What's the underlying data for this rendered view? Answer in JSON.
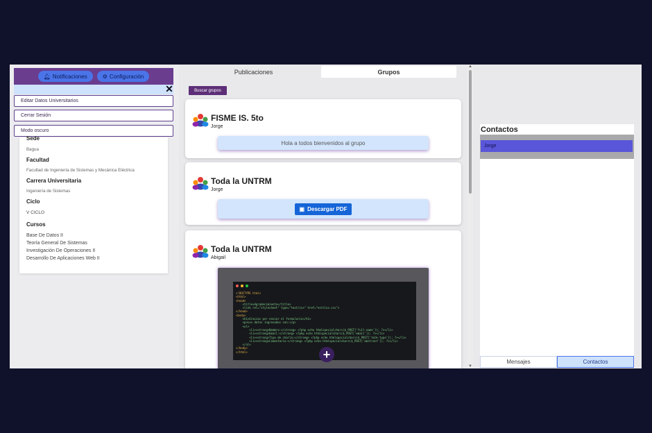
{
  "left": {
    "notifications_label": "Notificaciones",
    "settings_label": "Configuración",
    "close_label": "✕",
    "menu": [
      {
        "label": "Editar Datos Universitarios"
      },
      {
        "label": "Cerrar Sesión"
      },
      {
        "label": "Modo oscuro"
      }
    ],
    "profile": {
      "sede_label": "Sede",
      "sede_value": "Bagua",
      "facultad_label": "Facultad",
      "facultad_value": "Facultad de Ingeniería de Sistemas y Mecánica Eléctrica",
      "carrera_label": "Carrera Universitaria",
      "carrera_value": "Ingeniería de Sistemas",
      "ciclo_label": "Ciclo",
      "ciclo_value": "V CICLO",
      "cursos_label": "Cursos",
      "cursos": [
        "Base De Datos II",
        "Teoría General De Sistemas",
        "Investigación De Operaciones II",
        "Desarrollo De Aplicaciones Web II"
      ]
    }
  },
  "center": {
    "tabs": [
      {
        "label": "Publicaciones"
      },
      {
        "label": "Grupos"
      }
    ],
    "search_button": "Buscar grupos",
    "posts": [
      {
        "title": "FISME IS. 5to",
        "author": "Jorge",
        "message": "Hola a todos bienvenidos al grupo"
      },
      {
        "title": "Toda la UNTRM",
        "author": "Jorge",
        "download_label": "Descargar PDF"
      },
      {
        "title": "Toda la UNTRM",
        "author": "Abigail"
      }
    ],
    "code_lines": [
      "<!DOCTYPE html>",
      "<html>",
      "<head>",
      "    <title>Agradecimiento</title>",
      "    <link rel=\"stylesheet\" type=\"text/css\" href=\"estilos.css\">",
      "</head>",
      "<body>",
      "    <h1>Gracias por enviar el formulario</h1>",
      "    <p>Los datos ingresados son:</p>",
      "    <ul>",
      "        <li><strong>Nombre:</strong> <?php echo htmlspecialchars($_POST['full-name']); ?></li>",
      "        <li><strong>Email:</strong> <?php echo htmlspecialchars($_POST['email']); ?></li>",
      "        <li><strong>Tipo de charla:</strong> <?php echo htmlspecialchars($_POST['talk-type']); ?></li>",
      "        <li><strong>Comentario:</strong> <?php echo htmlspecialchars($_POST['abstract']); ?></li>",
      "    </ul>",
      "</body>",
      "</html>"
    ],
    "add_label": "+"
  },
  "right": {
    "contacts_title": "Contactos",
    "contacts": [
      {
        "name": "Jorge"
      }
    ],
    "bottom_tabs": [
      {
        "label": "Mensajes"
      },
      {
        "label": "Contactos"
      }
    ]
  },
  "colors": {
    "page_bg": "#10112a",
    "accent_purple": "#5e2f78",
    "accent_blue": "#1565d8",
    "pill_blue": "#4a74e8",
    "light_blue": "#cfe2fb",
    "contact_selected": "#5a56d9"
  },
  "icons": {
    "notifications": "bell-icon",
    "settings": "gear-icon",
    "group": "group-people-icon",
    "download": "pdf-file-icon"
  }
}
